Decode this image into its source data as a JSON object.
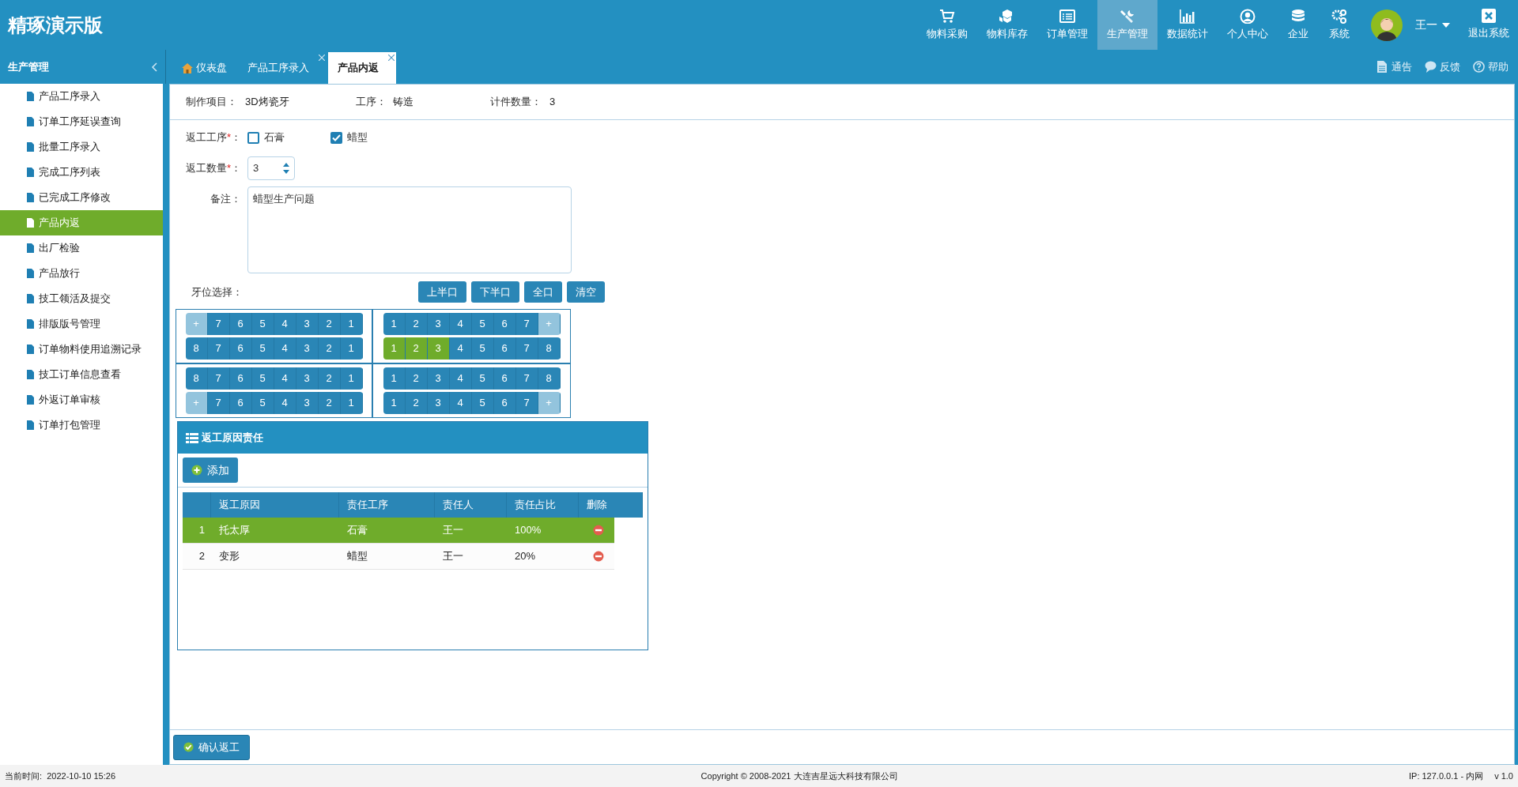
{
  "app_title": "精琢演示版",
  "nav": [
    {
      "label": "物料采购",
      "selected": false
    },
    {
      "label": "物料库存",
      "selected": false
    },
    {
      "label": "订单管理",
      "selected": false
    },
    {
      "label": "生产管理",
      "selected": true
    },
    {
      "label": "数据统计",
      "selected": false
    },
    {
      "label": "个人中心",
      "selected": false
    },
    {
      "label": "企业",
      "selected": false
    },
    {
      "label": "系统",
      "selected": false
    }
  ],
  "user": {
    "name": "王一"
  },
  "exit_label": "退出系统",
  "sidebar": {
    "title": "生产管理",
    "items": [
      {
        "label": "产品工序录入",
        "selected": false
      },
      {
        "label": "订单工序延误查询",
        "selected": false
      },
      {
        "label": "批量工序录入",
        "selected": false
      },
      {
        "label": "完成工序列表",
        "selected": false
      },
      {
        "label": "已完成工序修改",
        "selected": false
      },
      {
        "label": "产品内返",
        "selected": true
      },
      {
        "label": "出厂检验",
        "selected": false
      },
      {
        "label": "产品放行",
        "selected": false
      },
      {
        "label": "技工领活及提交",
        "selected": false
      },
      {
        "label": "排版版号管理",
        "selected": false
      },
      {
        "label": "订单物料使用追溯记录",
        "selected": false
      },
      {
        "label": "技工订单信息查看",
        "selected": false
      },
      {
        "label": "外返订单审核",
        "selected": false
      },
      {
        "label": "订单打包管理",
        "selected": false
      }
    ]
  },
  "tabs": [
    {
      "label": "仪表盘",
      "selected": false
    },
    {
      "label": "产品工序录入",
      "selected": false
    },
    {
      "label": "产品内返",
      "selected": true
    }
  ],
  "header_links": [
    {
      "label": "通告"
    },
    {
      "label": "反馈"
    },
    {
      "label": "帮助"
    }
  ],
  "info": [
    {
      "label": "制作项目：",
      "value": "3D烤瓷牙"
    },
    {
      "label": "工序：",
      "value": "铸造"
    },
    {
      "label": "计件数量：",
      "value": "3"
    }
  ],
  "form": {
    "rework_process": {
      "label": "返工工序",
      "required_mark": "*",
      "colon": "：",
      "options": [
        {
          "label": "石膏",
          "checked": false
        },
        {
          "label": "蜡型",
          "checked": true
        }
      ]
    },
    "rework_quantity": {
      "label": "返工数量",
      "required_mark": "*",
      "colon": "：",
      "value": "3"
    },
    "remark": {
      "label": "备注：",
      "value": "蜡型生产问题"
    }
  },
  "tooth_select": {
    "label": "牙位选择：",
    "buttons": [
      "上半口",
      "下半口",
      "全口",
      "清空"
    ],
    "quadrants": [
      {
        "rows": [
          [
            {
              "label": "+",
              "kind": "add"
            },
            {
              "label": "7",
              "kind": "tooth",
              "selected": false
            },
            {
              "label": "6",
              "kind": "tooth",
              "selected": false
            },
            {
              "label": "5",
              "kind": "tooth",
              "selected": false
            },
            {
              "label": "4",
              "kind": "tooth",
              "selected": false
            },
            {
              "label": "3",
              "kind": "tooth",
              "selected": false
            },
            {
              "label": "2",
              "kind": "tooth",
              "selected": false
            },
            {
              "label": "1",
              "kind": "tooth",
              "selected": false
            }
          ],
          [
            {
              "label": "8",
              "kind": "tooth",
              "selected": false
            },
            {
              "label": "7",
              "kind": "tooth",
              "selected": false
            },
            {
              "label": "6",
              "kind": "tooth",
              "selected": false
            },
            {
              "label": "5",
              "kind": "tooth",
              "selected": false
            },
            {
              "label": "4",
              "kind": "tooth",
              "selected": false
            },
            {
              "label": "3",
              "kind": "tooth",
              "selected": false
            },
            {
              "label": "2",
              "kind": "tooth",
              "selected": false
            },
            {
              "label": "1",
              "kind": "tooth",
              "selected": false
            }
          ]
        ]
      },
      {
        "rows": [
          [
            {
              "label": "1",
              "kind": "tooth",
              "selected": false
            },
            {
              "label": "2",
              "kind": "tooth",
              "selected": false
            },
            {
              "label": "3",
              "kind": "tooth",
              "selected": false
            },
            {
              "label": "4",
              "kind": "tooth",
              "selected": false
            },
            {
              "label": "5",
              "kind": "tooth",
              "selected": false
            },
            {
              "label": "6",
              "kind": "tooth",
              "selected": false
            },
            {
              "label": "7",
              "kind": "tooth",
              "selected": false
            },
            {
              "label": "+",
              "kind": "add"
            }
          ],
          [
            {
              "label": "1",
              "kind": "tooth",
              "selected": true
            },
            {
              "label": "2",
              "kind": "tooth",
              "selected": true
            },
            {
              "label": "3",
              "kind": "tooth",
              "selected": true
            },
            {
              "label": "4",
              "kind": "tooth",
              "selected": false
            },
            {
              "label": "5",
              "kind": "tooth",
              "selected": false
            },
            {
              "label": "6",
              "kind": "tooth",
              "selected": false
            },
            {
              "label": "7",
              "kind": "tooth",
              "selected": false
            },
            {
              "label": "8",
              "kind": "tooth",
              "selected": false
            }
          ]
        ]
      },
      {
        "rows": [
          [
            {
              "label": "8",
              "kind": "tooth",
              "selected": false
            },
            {
              "label": "7",
              "kind": "tooth",
              "selected": false
            },
            {
              "label": "6",
              "kind": "tooth",
              "selected": false
            },
            {
              "label": "5",
              "kind": "tooth",
              "selected": false
            },
            {
              "label": "4",
              "kind": "tooth",
              "selected": false
            },
            {
              "label": "3",
              "kind": "tooth",
              "selected": false
            },
            {
              "label": "2",
              "kind": "tooth",
              "selected": false
            },
            {
              "label": "1",
              "kind": "tooth",
              "selected": false
            }
          ],
          [
            {
              "label": "+",
              "kind": "add"
            },
            {
              "label": "7",
              "kind": "tooth",
              "selected": false
            },
            {
              "label": "6",
              "kind": "tooth",
              "selected": false
            },
            {
              "label": "5",
              "kind": "tooth",
              "selected": false
            },
            {
              "label": "4",
              "kind": "tooth",
              "selected": false
            },
            {
              "label": "3",
              "kind": "tooth",
              "selected": false
            },
            {
              "label": "2",
              "kind": "tooth",
              "selected": false
            },
            {
              "label": "1",
              "kind": "tooth",
              "selected": false
            }
          ]
        ]
      },
      {
        "rows": [
          [
            {
              "label": "1",
              "kind": "tooth",
              "selected": false
            },
            {
              "label": "2",
              "kind": "tooth",
              "selected": false
            },
            {
              "label": "3",
              "kind": "tooth",
              "selected": false
            },
            {
              "label": "4",
              "kind": "tooth",
              "selected": false
            },
            {
              "label": "5",
              "kind": "tooth",
              "selected": false
            },
            {
              "label": "6",
              "kind": "tooth",
              "selected": false
            },
            {
              "label": "7",
              "kind": "tooth",
              "selected": false
            },
            {
              "label": "8",
              "kind": "tooth",
              "selected": false
            }
          ],
          [
            {
              "label": "1",
              "kind": "tooth",
              "selected": false
            },
            {
              "label": "2",
              "kind": "tooth",
              "selected": false
            },
            {
              "label": "3",
              "kind": "tooth",
              "selected": false
            },
            {
              "label": "4",
              "kind": "tooth",
              "selected": false
            },
            {
              "label": "5",
              "kind": "tooth",
              "selected": false
            },
            {
              "label": "6",
              "kind": "tooth",
              "selected": false
            },
            {
              "label": "7",
              "kind": "tooth",
              "selected": false
            },
            {
              "label": "+",
              "kind": "add"
            }
          ]
        ]
      }
    ]
  },
  "reason_panel": {
    "title": "返工原因责任",
    "add_button": "添加",
    "columns": [
      "返工原因",
      "责任工序",
      "责任人",
      "责任占比",
      "删除"
    ],
    "rows": [
      {
        "index": "1",
        "reason": "托太厚",
        "process": "石膏",
        "person": "王一",
        "ratio": "100%",
        "selected": true
      },
      {
        "index": "2",
        "reason": "变形",
        "process": "蜡型",
        "person": "王一",
        "ratio": "20%",
        "selected": false
      }
    ]
  },
  "confirm_button": "确认返工",
  "status_bar": {
    "time": "当前时间:  2022-10-10 15:26",
    "copyright": "Copyright © 2008-2021 大连吉星远大科技有限公司",
    "ip": "IP: 127.0.0.1 - 内网",
    "version": "v 1.0"
  }
}
